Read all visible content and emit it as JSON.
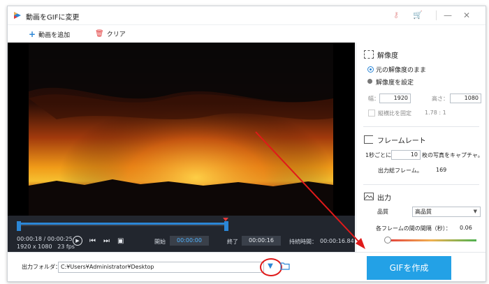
{
  "window": {
    "title": "動画をGIFに変更",
    "minimize_icon": "minimize-icon",
    "maximize_icon": "maximize-icon",
    "close_icon": "close-icon"
  },
  "toolbar": {
    "add_label": "動画を追加",
    "clear_label": "クリア"
  },
  "player": {
    "current_time": "00:00:18",
    "total_time": "00:00:25",
    "time_sep": "/",
    "resolution": "1920 x 1080",
    "fps": "23 fps",
    "start_label": "開始",
    "start_value": "00:00:00",
    "end_label": "終了",
    "end_value": "00:00:16",
    "duration_label": "持続時間：",
    "duration_value": "00:00:16.84"
  },
  "output": {
    "folder_label": "出力フォルダ：",
    "folder_path": "C:¥Users¥Administrator¥Desktop",
    "create_button": "GIFを作成"
  },
  "resolution_section": {
    "title": "解像度",
    "keep_original": "元の解像度のまま",
    "set_resolution": "解像度を設定",
    "width_label": "幅：",
    "width_value": "1920",
    "height_label": "高さ：",
    "height_value": "1080",
    "aspect_label": "縦横比を固定",
    "aspect_value": "1.78 : 1"
  },
  "framerate_section": {
    "title": "フレームレート",
    "per_second_prefix": "1秒ごとに",
    "per_second_value": "10",
    "per_second_suffix": "枚の写真をキャプチャ。",
    "total_frames_label": "出力総フレーム。",
    "total_frames_value": "169"
  },
  "output_section": {
    "title": "出力",
    "quality_label": "品質",
    "quality_value": "高品質",
    "interval_label": "各フレームの間の間隔（秒）：",
    "interval_value": "0.06"
  },
  "colors": {
    "accent": "#23a1e6",
    "annotation_red": "#e01a1a"
  }
}
